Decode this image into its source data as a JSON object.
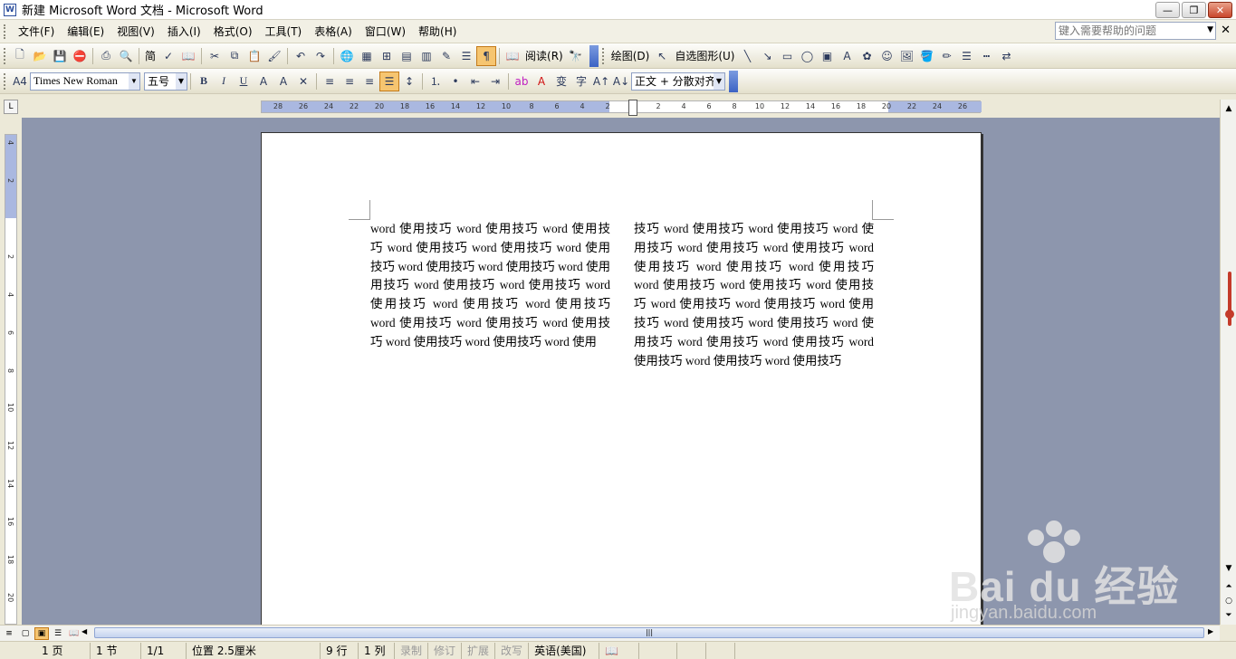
{
  "window": {
    "title": "新建 Microsoft Word 文档 - Microsoft Word",
    "app_icon_glyph": "W",
    "min_glyph": "—",
    "restore_glyph": "❐",
    "close_glyph": "✕"
  },
  "menu": {
    "items": [
      "文件(F)",
      "编辑(E)",
      "视图(V)",
      "插入(I)",
      "格式(O)",
      "工具(T)",
      "表格(A)",
      "窗口(W)",
      "帮助(H)"
    ],
    "help_placeholder": "键入需要帮助的问题",
    "doc_close": "✕"
  },
  "toolbar_standard": {
    "reading_label": "阅读(R)",
    "draw_label": "绘图(D)",
    "autoshapes_label": "自选图形(U)",
    "icons": [
      "new-doc-icon",
      "open-icon",
      "save-icon",
      "permission-icon",
      "print-icon",
      "print-preview-icon",
      "simplified-chinese-icon",
      "spelling-icon",
      "research-icon",
      "cut-icon",
      "copy-icon",
      "paste-icon",
      "format-painter-icon",
      "undo-icon",
      "redo-icon",
      "hyperlink-icon",
      "tables-borders-icon",
      "insert-table-icon",
      "insert-excel-icon",
      "columns-icon",
      "drawing-icon",
      "document-map-icon",
      "show-hide-icon"
    ],
    "simp_label": "简"
  },
  "toolbar_format": {
    "style_icon": "A4",
    "font": "Times New Roman",
    "size": "五号",
    "bold": "B",
    "italic": "I",
    "underline": "U",
    "style_name": "正文 + 分散对齐",
    "char_a": "A",
    "pinyin": "变",
    "enclose": "字"
  },
  "ruler": {
    "corner": "L",
    "h_ticks": [
      "28",
      "26",
      "24",
      "22",
      "20",
      "18",
      "16",
      "14",
      "12",
      "10",
      "8",
      "6",
      "4",
      "2",
      "2",
      "4",
      "6",
      "8",
      "10",
      "12",
      "14",
      "16",
      "18",
      "20",
      "22",
      "24",
      "26"
    ],
    "v_ticks": [
      "4",
      "2",
      "2",
      "4",
      "6",
      "8",
      "10",
      "12",
      "14",
      "16",
      "18",
      "20"
    ]
  },
  "document": {
    "column_left": [
      "word 使用技巧 word 使用技巧 word 使用技",
      "巧 word 使用技巧 word 使用技巧 word 使用",
      "技巧 word 使用技巧 word 使用技巧 word 使用",
      "用技巧 word 使用技巧 word 使用技巧 word",
      "使用技巧 word 使用技巧 word 使用技巧",
      "word 使用技巧 word 使用技巧 word 使用技",
      "巧 word 使用技巧 word 使用技巧 word 使用"
    ],
    "column_right": [
      "技巧 word 使用技巧 word 使用技巧 word 使",
      "用技巧 word 使用技巧 word 使用技巧 word",
      "使用技巧 word 使用技巧 word 使用技巧",
      "word 使用技巧 word 使用技巧 word 使用技",
      "巧 word 使用技巧 word 使用技巧 word 使用",
      "技巧 word 使用技巧 word 使用技巧 word 使",
      "用技巧 word 使用技巧 word 使用技巧 word",
      "使用技巧 word 使用技巧 word 使用技巧"
    ]
  },
  "status": {
    "page": "1 页",
    "section": "1 节",
    "page_of": "1/1",
    "position": "位置 2.5厘米",
    "line": "9 行",
    "column": "1 列",
    "rec": "录制",
    "trk": "修订",
    "ext": "扩展",
    "ovr": "改写",
    "language": "英语(美国)"
  },
  "watermark": {
    "brand": "Bai du 经验",
    "url": "jingyan.baidu.com"
  },
  "colors": {
    "workspace": "#8d96ad",
    "active_button": "#f6c570",
    "ruler_band": "#aab8e0"
  }
}
